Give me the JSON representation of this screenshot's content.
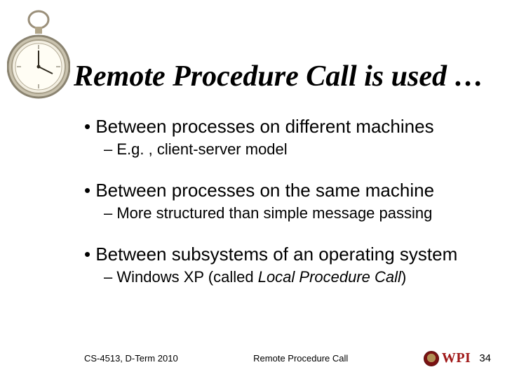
{
  "title": "Remote Procedure Call is used …",
  "bullets": [
    {
      "text": "Between processes on different machines",
      "sub": "E.g. , client-server model"
    },
    {
      "text": "Between processes on the same machine",
      "sub": "More structured than simple message passing"
    },
    {
      "text": "Between subsystems of an operating system",
      "sub_prefix": "Windows XP (called ",
      "sub_italic": "Local Procedure Call",
      "sub_suffix": ")"
    }
  ],
  "footer": {
    "left": "CS-4513, D-Term 2010",
    "center": "Remote Procedure Call",
    "logo_text": "WPI",
    "slide_number": "34"
  }
}
